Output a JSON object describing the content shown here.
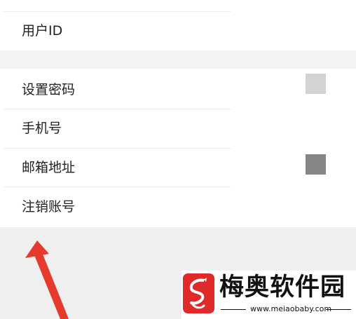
{
  "settings": {
    "rows": [
      {
        "label": "用户ID"
      },
      {
        "label": "设置密码"
      },
      {
        "label": "手机号"
      },
      {
        "label": "邮箱地址"
      },
      {
        "label": "注销账号"
      }
    ]
  },
  "watermark": {
    "name": "梅奥软件园",
    "url": "www.meiaobaby.com"
  },
  "colors": {
    "arrow": "#e53a2c",
    "logo_bg": "#e02a2a",
    "square_light": "#d3d3d3",
    "square_dark": "#858585"
  },
  "icons": {
    "arrow": "red-arrow-icon",
    "logo": "dragon-logo-icon"
  }
}
